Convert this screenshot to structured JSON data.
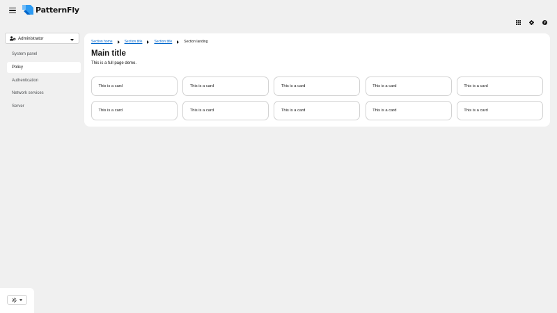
{
  "header": {
    "brand": "PatternFly",
    "tools": [
      "apps-grid-icon",
      "gear-icon",
      "help-icon"
    ]
  },
  "sidebar": {
    "perspective": {
      "label": "Administrator"
    },
    "items": [
      {
        "label": "System panel",
        "active": false
      },
      {
        "label": "Policy",
        "active": true
      },
      {
        "label": "Authentication",
        "active": false
      },
      {
        "label": "Network services",
        "active": false
      },
      {
        "label": "Server",
        "active": false
      }
    ],
    "theme_switcher": {
      "icon": "sun-icon"
    }
  },
  "main": {
    "breadcrumb": [
      "Section home",
      "Section title",
      "Section title",
      "Section landing"
    ],
    "title": "Main title",
    "subtitle": "This is a full page demo.",
    "cards": [
      "This is a card",
      "This is a card",
      "This is a card",
      "This is a card",
      "This is a card",
      "This is a card",
      "This is a card",
      "This is a card",
      "This is a card",
      "This is a card"
    ]
  },
  "colors": {
    "link": "#0066cc",
    "page_background": "#f0f0f0",
    "panel": "#ffffff",
    "border": "#d2d2d2"
  }
}
